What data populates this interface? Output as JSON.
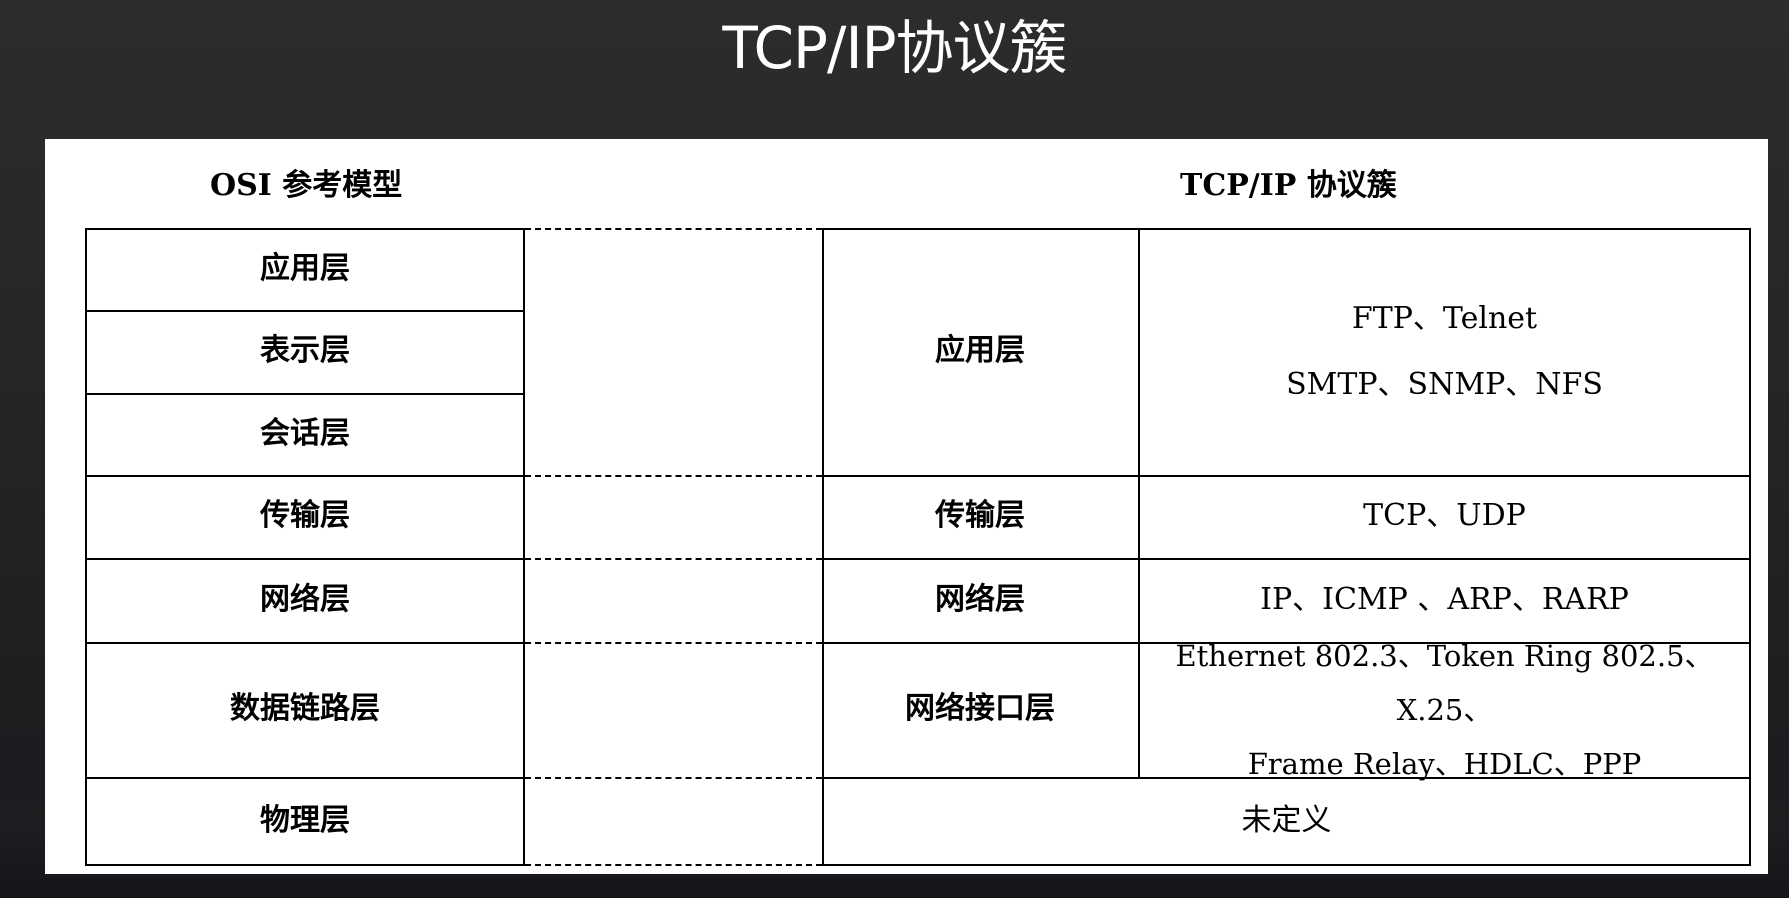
{
  "title": "TCP/IP协议簇",
  "osi_header": "OSI 参考模型",
  "tcpip_header": "TCP/IP 协议簇",
  "osi_layers": [
    "应用层",
    "表示层",
    "会话层",
    "传输层",
    "网络层",
    "数据链路层",
    "物理层"
  ],
  "tcpip_layers": [
    "应用层",
    "传输层",
    "网络层",
    "网络接口层"
  ],
  "protocols": {
    "application_line1": "FTP、Telnet",
    "application_line2": "SMTP、SNMP、NFS",
    "transport": "TCP、UDP",
    "network": "IP、ICMP 、ARP、RARP",
    "link_line1": "Ethernet 802.3、Token Ring 802.5、X.25、",
    "link_line2": "Frame Relay、HDLC、PPP"
  },
  "physical_tcpip": "未定义"
}
